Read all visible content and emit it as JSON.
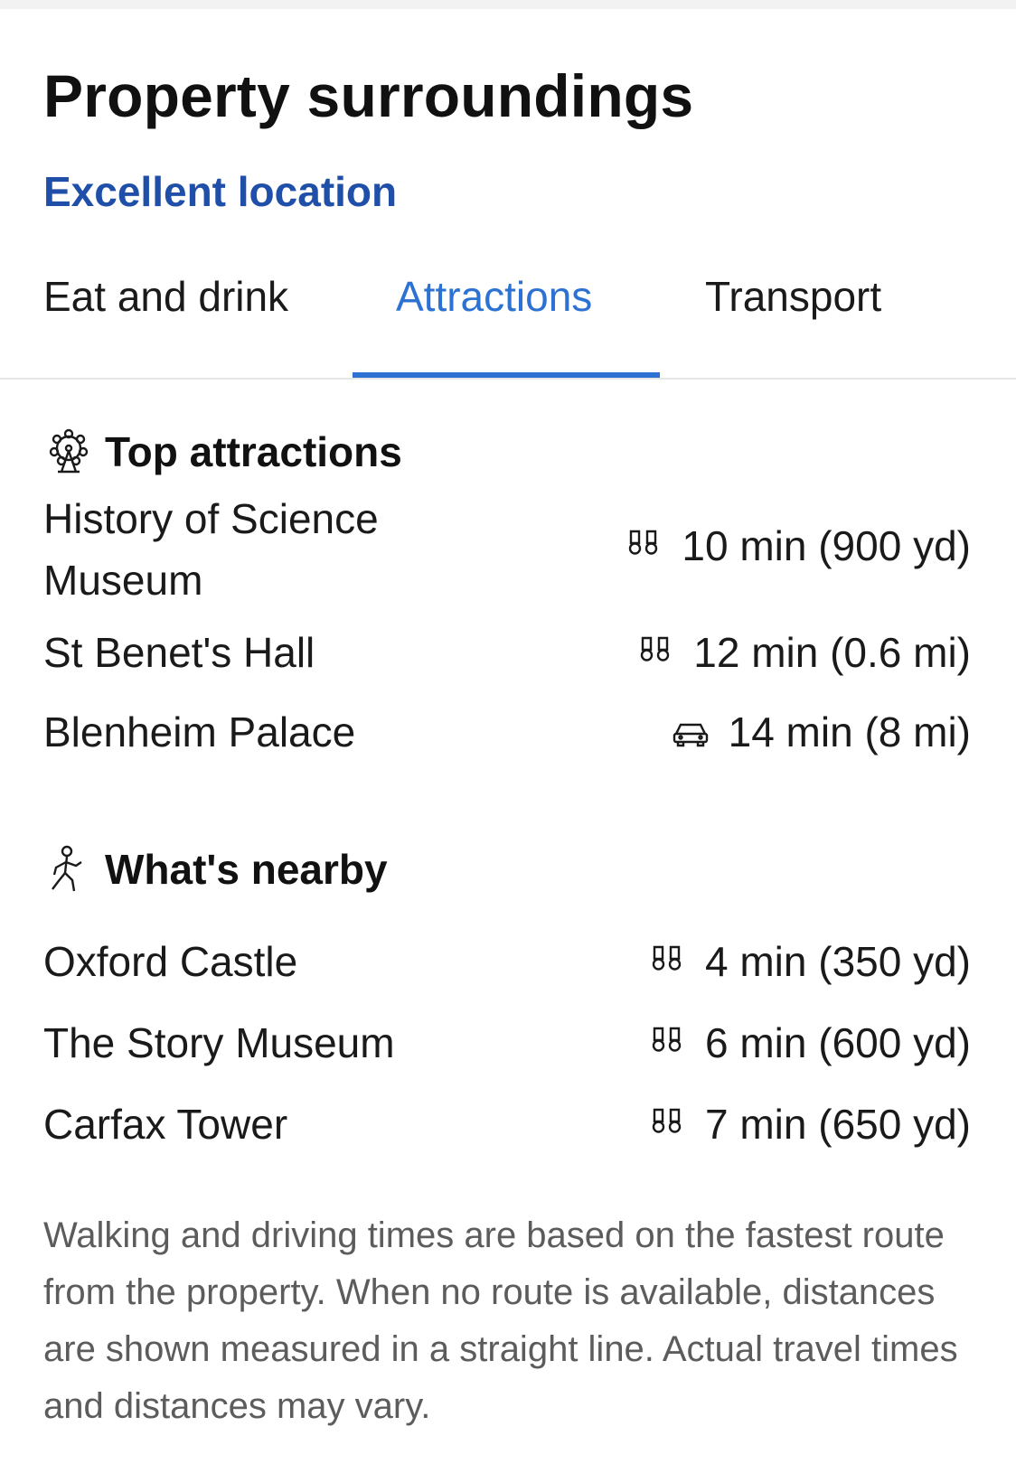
{
  "header": {
    "title": "Property surroundings",
    "subtitle": "Excellent location"
  },
  "tabs": [
    {
      "label": "Eat and drink",
      "active": false
    },
    {
      "label": "Attractions",
      "active": true
    },
    {
      "label": "Transport",
      "active": false
    }
  ],
  "colors": {
    "accent": "#2d72d2",
    "subtitle": "#1f4fa8",
    "muted": "#5c5c5c"
  },
  "top_attractions": {
    "title": "Top attractions",
    "icon": "ferris-wheel-icon",
    "items": [
      {
        "name": "History of Science Museum",
        "mode_icon": "walking-icon",
        "distance": "10 min (900 yd)"
      },
      {
        "name": "St Benet's Hall",
        "mode_icon": "walking-icon",
        "distance": "12 min (0.6 mi)"
      },
      {
        "name": "Blenheim Palace",
        "mode_icon": "car-icon",
        "distance": "14 min (8 mi)"
      }
    ]
  },
  "whats_nearby": {
    "title": "What's nearby",
    "icon": "pedestrian-icon",
    "items": [
      {
        "name": "Oxford Castle",
        "mode_icon": "walking-icon",
        "distance": "4 min (350 yd)"
      },
      {
        "name": "The Story Museum",
        "mode_icon": "walking-icon",
        "distance": "6 min (600 yd)"
      },
      {
        "name": "Carfax Tower",
        "mode_icon": "walking-icon",
        "distance": "7 min (650 yd)"
      }
    ]
  },
  "footnote": "Walking and driving times are based on the fastest route from the property. When no route is available, distances are shown measured in a straight line. Actual travel times and distances may vary."
}
